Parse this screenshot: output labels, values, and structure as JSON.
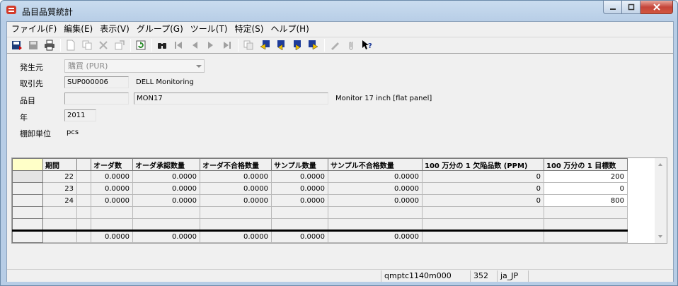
{
  "window": {
    "title": "品目品質統計"
  },
  "menu": [
    "ファイル(F)",
    "編集(E)",
    "表示(V)",
    "グループ(G)",
    "ツール(T)",
    "特定(S)",
    "ヘルプ(H)"
  ],
  "form": {
    "source_label": "発生元",
    "source_value": "購買 (PUR)",
    "supplier_label": "取引先",
    "supplier_code": "SUP000006",
    "supplier_name": "DELL Monitoring",
    "item_label": "品目",
    "item_value": "",
    "item_code": "MON17",
    "item_description": "Monitor 17 inch [flat panel]",
    "year_label": "年",
    "year_value": "2011",
    "unit_label": "棚卸単位",
    "unit_value": "pcs"
  },
  "grid": {
    "columns": [
      "期間",
      "",
      "オーダ数",
      "オーダ承認数量",
      "オーダ不合格数量",
      "サンプル数量",
      "サンプル不合格数量",
      "100 万分の 1 欠陥品数 (PPM)",
      "100 万分の 1 目標数"
    ],
    "rows": [
      [
        "22",
        "",
        "0.0000",
        "0.0000",
        "0.0000",
        "0.0000",
        "0.0000",
        "0",
        "200"
      ],
      [
        "23",
        "",
        "0.0000",
        "0.0000",
        "0.0000",
        "0.0000",
        "0.0000",
        "0",
        "0"
      ],
      [
        "24",
        "",
        "0.0000",
        "0.0000",
        "0.0000",
        "0.0000",
        "0.0000",
        "0",
        "800"
      ],
      [
        "",
        "",
        "",
        "",
        "",
        "",
        "",
        "",
        ""
      ],
      [
        "",
        "",
        "",
        "",
        "",
        "",
        "",
        "",
        ""
      ]
    ],
    "totals": [
      "",
      "",
      "0.0000",
      "0.0000",
      "0.0000",
      "0.0000",
      "0.0000",
      "",
      ""
    ]
  },
  "status": {
    "session": "qmptc1140m000",
    "company": "352",
    "language": "ja_JP"
  },
  "colors": {
    "close_button": "#c5453a",
    "grid_corner": "#ffffc8"
  }
}
